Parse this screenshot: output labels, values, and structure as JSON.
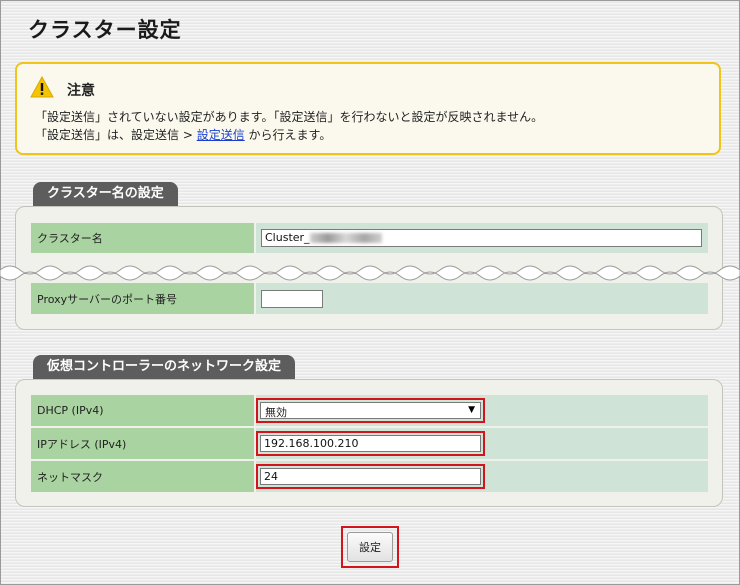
{
  "page": {
    "title": "クラスター設定"
  },
  "notice": {
    "title": "注意",
    "line1": "「設定送信」されていない設定があります。「設定送信」を行わないと設定が反映されません。",
    "line2_prefix": "「設定送信」は、設定送信 > ",
    "line2_link": "設定送信",
    "line2_suffix": " から行えます。",
    "icon": "warning-icon"
  },
  "cluster_name_section": {
    "tab": "クラスター名の設定",
    "rows": [
      {
        "label": "クラスター名",
        "value": "Cluster_"
      },
      {
        "label": "Proxyサーバーのポート番号",
        "value": ""
      }
    ]
  },
  "network_section": {
    "tab": "仮想コントローラーのネットワーク設定",
    "rows": [
      {
        "label": "DHCP (IPv4)",
        "value": "無効"
      },
      {
        "label": "IPアドレス (IPv4)",
        "value": "192.168.100.210"
      },
      {
        "label": "ネットマスク",
        "value": "24"
      }
    ]
  },
  "submit": {
    "label": "設定"
  },
  "colors": {
    "highlight": "#d4141c",
    "label_bg": "#a9d3a1",
    "value_bg": "#cfe4d6",
    "notice_border": "#f0c419",
    "tab_bg": "#5d5d5d"
  }
}
